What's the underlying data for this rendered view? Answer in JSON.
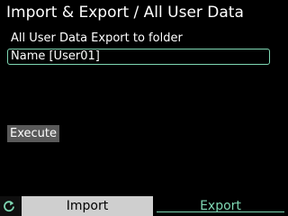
{
  "header": {
    "title": "Import & Export / All User Data"
  },
  "main": {
    "section_label": "All User Data Export to folder",
    "name_field": {
      "value": "Name [User01]"
    },
    "execute_label": "Execute"
  },
  "bottom_bar": {
    "back_icon": "refresh-back-icon",
    "tabs": [
      {
        "label": "Import",
        "selected": false
      },
      {
        "label": "Export",
        "selected": true
      }
    ]
  },
  "colors": {
    "accent": "#7fd8b4",
    "background": "#000000",
    "button": "#5a5a5a",
    "inactive_tab": "#cfcfcf"
  }
}
